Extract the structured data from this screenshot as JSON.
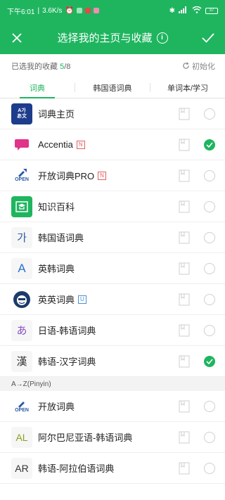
{
  "status": {
    "time": "下午6:01",
    "speed": "3.6K/s",
    "battery": "37"
  },
  "header": {
    "title": "选择我的主页与收藏",
    "confirm_icon": "check-icon",
    "close_icon": "close-icon"
  },
  "counter": {
    "label": "已选我的收藏",
    "selected": "5",
    "total": "/8",
    "reset_label": "初始化"
  },
  "tabs": [
    {
      "label": "词典",
      "active": true
    },
    {
      "label": "韩国语词典",
      "active": false
    },
    {
      "label": "单词本/学习",
      "active": false
    }
  ],
  "items": [
    {
      "name": "词典主页",
      "icon_text": "A가\nあ文",
      "tag": "",
      "checked": false
    },
    {
      "name": "Accentia",
      "icon_text": "",
      "tag": "N",
      "checked": true
    },
    {
      "name": "开放词典PRO",
      "icon_text": "OPEN",
      "tag": "N",
      "checked": false
    },
    {
      "name": "知识百科",
      "icon_text": "",
      "tag": "",
      "checked": false
    },
    {
      "name": "韩国语词典",
      "icon_text": "가",
      "tag": "",
      "checked": false
    },
    {
      "name": "英韩词典",
      "icon_text": "A",
      "tag": "",
      "checked": false
    },
    {
      "name": "英英词典",
      "icon_text": "",
      "tag": "U",
      "checked": false
    },
    {
      "name": "日语-韩语词典",
      "icon_text": "あ",
      "tag": "",
      "checked": false
    },
    {
      "name": "韩语-汉字词典",
      "icon_text": "漢",
      "tag": "",
      "checked": true
    }
  ],
  "section_label": "A→Z(Pinyin)",
  "az_items": [
    {
      "name": "开放词典",
      "icon_text": "OPEN",
      "tag": "",
      "checked": false
    },
    {
      "name": "阿尔巴尼亚语-韩语词典",
      "icon_text": "AL",
      "tag": "",
      "checked": false
    },
    {
      "name": "韩语-阿拉伯语词典",
      "icon_text": "AR",
      "tag": "",
      "checked": false
    }
  ],
  "colors": {
    "brand": "#1fb55f",
    "tag_n": "#e06060",
    "tag_u": "#4a8fd6"
  }
}
